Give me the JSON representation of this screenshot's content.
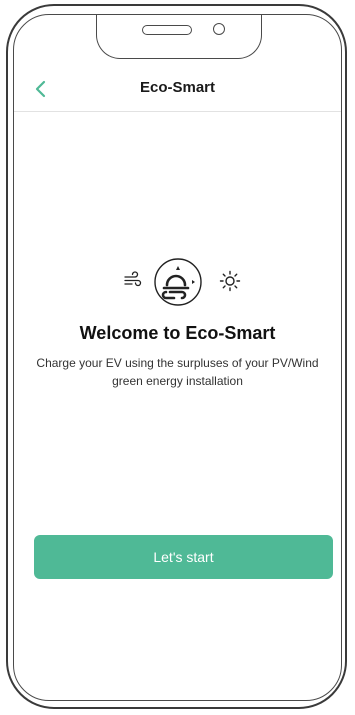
{
  "header": {
    "title": "Eco-Smart",
    "back_icon": "chevron-left-icon"
  },
  "hero": {
    "icons": [
      "wind-icon",
      "eco-smart-icon",
      "sun-icon"
    ],
    "title": "Welcome to Eco-Smart",
    "description": "Charge your EV using the surpluses of your PV/Wind green energy installation"
  },
  "cta": {
    "label": "Let's start"
  },
  "colors": {
    "accent": "#4fb996",
    "text": "#1a1a1a"
  }
}
